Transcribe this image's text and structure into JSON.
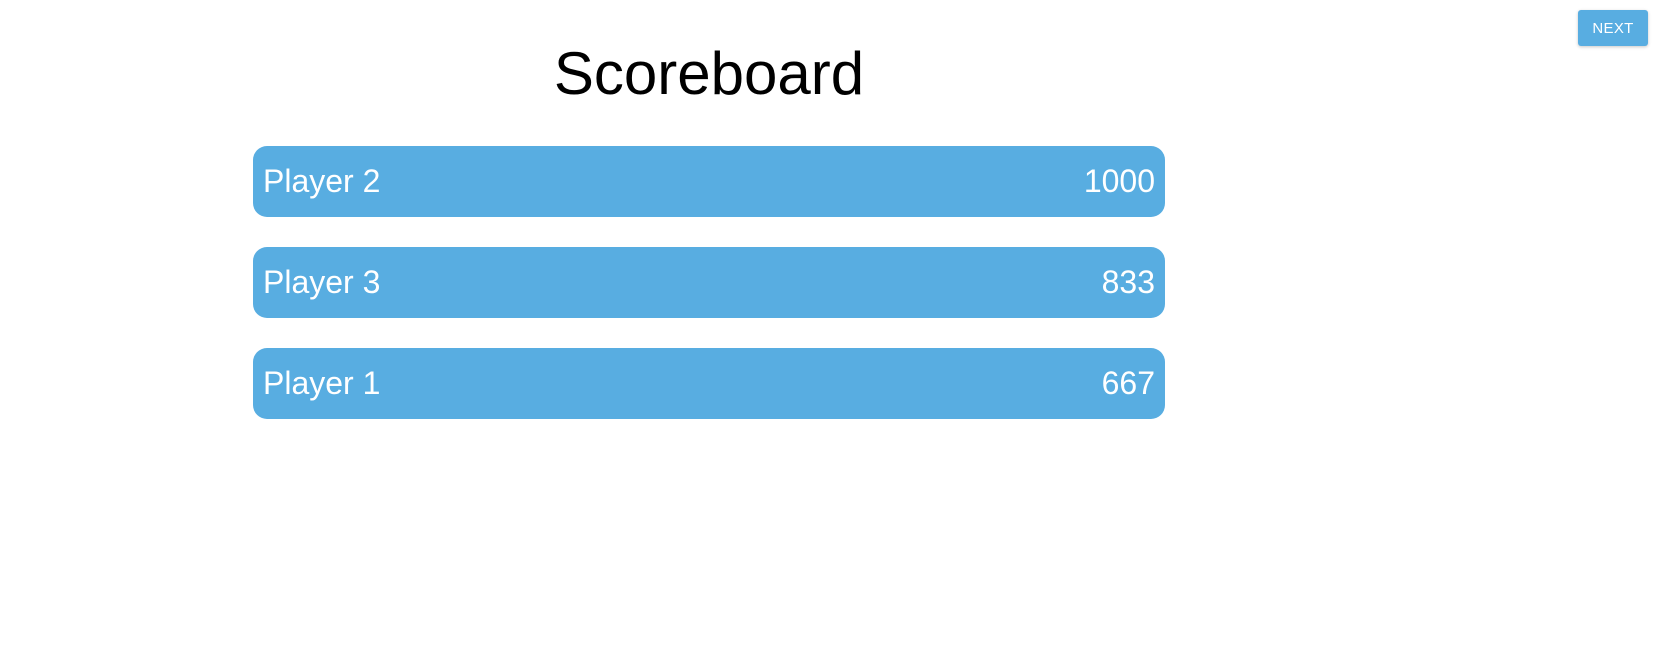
{
  "header": {
    "next_label": "NEXT",
    "title": "Scoreboard"
  },
  "scoreboard": {
    "rows": [
      {
        "player": "Player 2",
        "score": "1000"
      },
      {
        "player": "Player 3",
        "score": "833"
      },
      {
        "player": "Player 1",
        "score": "667"
      }
    ]
  },
  "colors": {
    "accent": "#58ade1",
    "text_on_accent": "#ffffff",
    "title": "#000000",
    "background": "#ffffff"
  }
}
